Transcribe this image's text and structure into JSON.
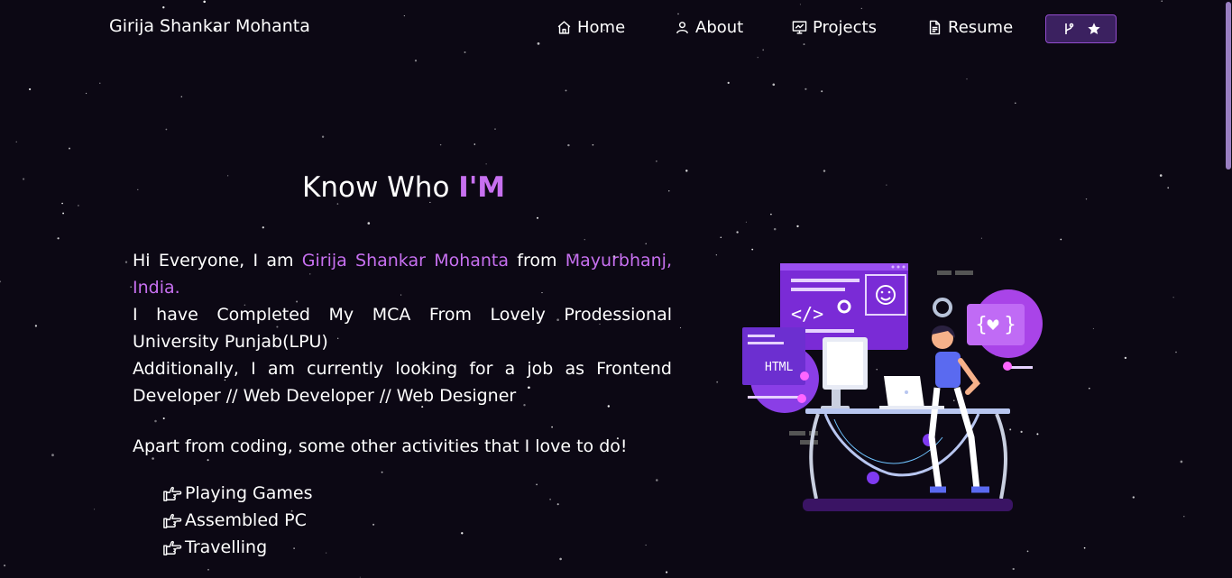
{
  "navbar": {
    "brand": "Girija Shankar Mohanta",
    "items": [
      {
        "label": "Home",
        "icon": "home-icon"
      },
      {
        "label": "About",
        "icon": "user-icon"
      },
      {
        "label": "Projects",
        "icon": "projects-icon"
      },
      {
        "label": "Resume",
        "icon": "document-icon"
      }
    ],
    "github_button": {
      "icons": [
        "git-branch-icon",
        "star-icon"
      ]
    }
  },
  "about": {
    "heading_prefix": "Know Who ",
    "heading_accent": "I'M",
    "intro": {
      "p1_a": "Hi Everyone, I am ",
      "name": "Girija Shankar Mohanta",
      "p1_b": " from ",
      "location": "Mayurbhanj, India.",
      "p2": "I have Completed My MCA From Lovely Prodessional University Punjab(LPU)",
      "p3": "Additionally, I am currently looking for a job as Frontend Developer // Web Developer // Web Designer"
    },
    "activities_title": "Apart from coding, some other activities that I love to do!",
    "activities": [
      {
        "label": "Playing Games",
        "icon": "pointing-hand-icon"
      },
      {
        "label": "Assembled PC",
        "icon": "pointing-hand-icon"
      },
      {
        "label": "Travelling",
        "icon": "pointing-hand-icon"
      }
    ],
    "illustration": {
      "html_tag": "HTML",
      "icon": "developer-illustration"
    }
  },
  "colors": {
    "background": "#0c0814",
    "accent": "#c770f0",
    "button_bg": "#3b2160",
    "button_border": "#934cce"
  }
}
